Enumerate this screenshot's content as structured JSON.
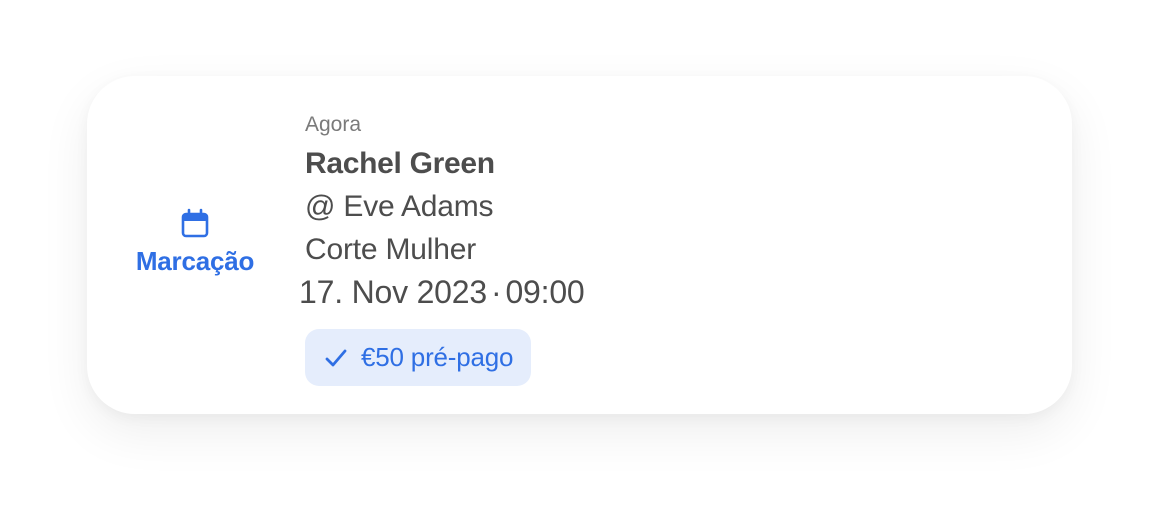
{
  "notification": {
    "type_label": "Marcação",
    "type_icon": "calendar-icon",
    "time": "Agora",
    "client_name": "Rachel Green",
    "staff": "@ Eve Adams",
    "service": "Corte Mulher",
    "date": "17. Nov 2023",
    "separator": "·",
    "hour": "09:00",
    "badge_text": "€50 pré-pago",
    "badge_icon": "check-icon"
  },
  "colors": {
    "accent": "#2f6fe4",
    "badge_bg": "#e5edfc",
    "text": "#4d4d4d",
    "muted": "#7a7a7a"
  }
}
